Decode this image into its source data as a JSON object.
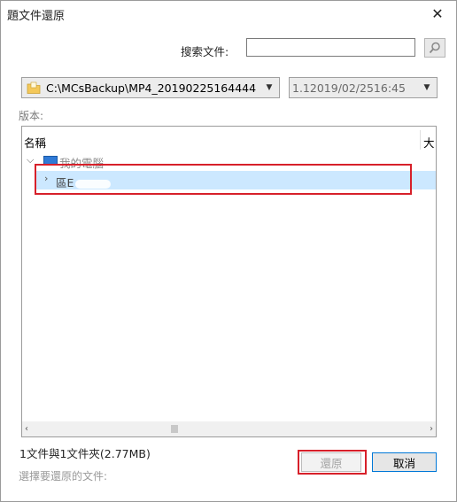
{
  "window": {
    "title": "題文件還原",
    "close_glyph": "✕"
  },
  "search": {
    "label": "搜索文件:",
    "value": "",
    "placeholder": "",
    "icon": "search-icon"
  },
  "path_dropdown": {
    "value": "C:\\MCsBackup\\MP4_20190225164444",
    "icon": "folder-icon"
  },
  "date_dropdown": {
    "value": "1.12019/02/2516:45"
  },
  "version_label": "版本:",
  "list": {
    "columns": {
      "name": "名稱",
      "size": "大"
    },
    "items": [
      {
        "label": "我的電腦",
        "icon": "computer-icon",
        "expanded": true
      },
      {
        "label": "區E",
        "expanded": false,
        "selected": true
      }
    ]
  },
  "summary": "1文件與1文件夾(2.77MB)",
  "hint": "選擇要還原的文件:",
  "buttons": {
    "restore": "還原",
    "cancel": "取消"
  },
  "colors": {
    "highlight_box": "#d7202a",
    "selection": "#cce8ff",
    "default_button_border": "#0078d7"
  }
}
